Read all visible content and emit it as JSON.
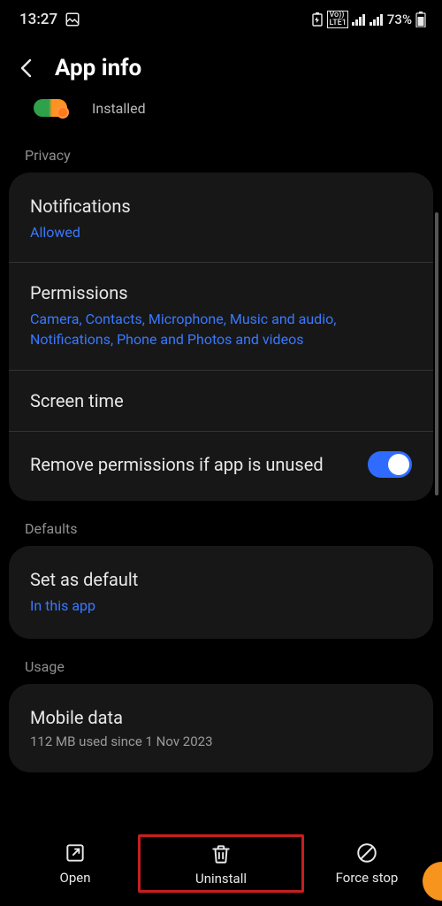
{
  "status": {
    "time": "13:27",
    "battery_pct": "73%"
  },
  "header": {
    "title": "App info"
  },
  "app": {
    "install_status": "Installed"
  },
  "sections": {
    "privacy_label": "Privacy",
    "defaults_label": "Defaults",
    "usage_label": "Usage"
  },
  "rows": {
    "notifications": {
      "title": "Notifications",
      "value": "Allowed"
    },
    "permissions": {
      "title": "Permissions",
      "value": "Camera, Contacts, Microphone, Music and audio, Notifications, Phone and Photos and videos"
    },
    "screen_time": {
      "title": "Screen time"
    },
    "remove_perms": {
      "title": "Remove permissions if app is unused"
    },
    "set_default": {
      "title": "Set as default",
      "value": "In this app"
    },
    "mobile_data": {
      "title": "Mobile data",
      "sub": "112 MB used since 1 Nov 2023"
    }
  },
  "bottom": {
    "open": "Open",
    "uninstall": "Uninstall",
    "force_stop": "Force stop"
  }
}
